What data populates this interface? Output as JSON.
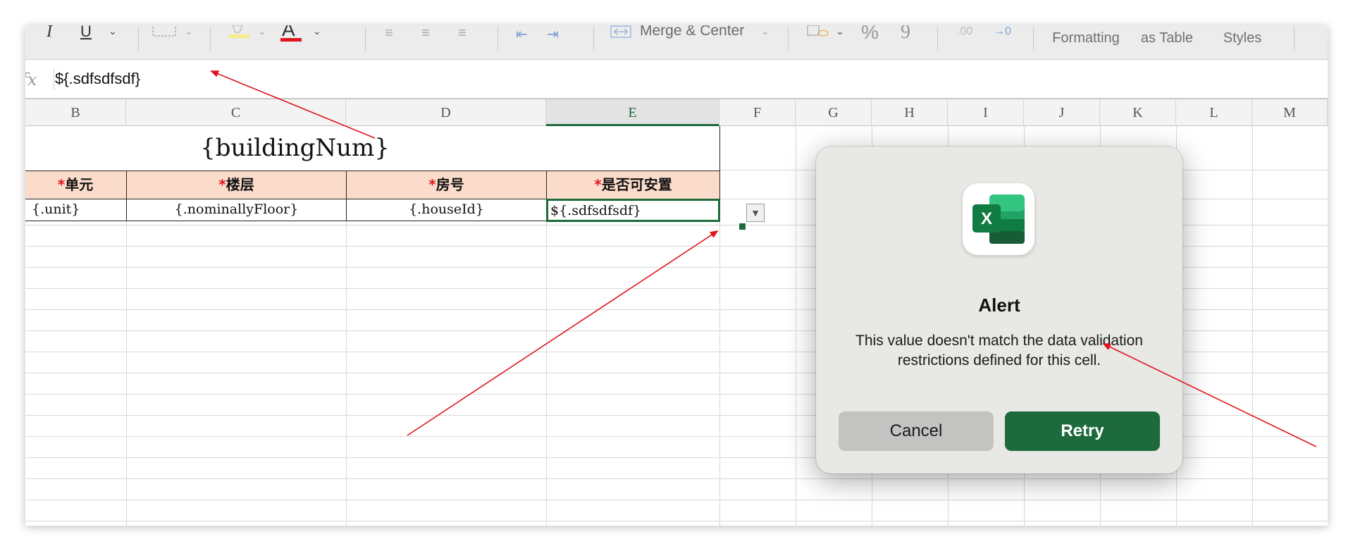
{
  "ribbon": {
    "italic_label": "I",
    "underline_label": "U",
    "font_color_label": "A",
    "merge_label": "Merge & Center",
    "percent_label": "%",
    "comma_label": "9",
    "conditional_formatting": "Conditional Formatting",
    "format_as_table": "Format as Table",
    "cell_styles": "Cell Styles"
  },
  "formula_bar": {
    "fx_label": "fx",
    "value": "${.sdfsdfsdf}"
  },
  "columns": [
    {
      "label": "B"
    },
    {
      "label": "C"
    },
    {
      "label": "D"
    },
    {
      "label": "E"
    },
    {
      "label": "F"
    },
    {
      "label": "G"
    },
    {
      "label": "H"
    },
    {
      "label": "I"
    },
    {
      "label": "J"
    },
    {
      "label": "K"
    },
    {
      "label": "L"
    },
    {
      "label": "M"
    }
  ],
  "sheet": {
    "title": "{buildingNum}",
    "star": "*",
    "headers": [
      "单元",
      "楼层",
      "房号",
      "是否可安置"
    ],
    "row": [
      "{.unit}",
      "{.nominallyFloor}",
      "{.houseId}",
      "${.sdfsdfsdf}"
    ]
  },
  "dialog": {
    "app_icon_letter": "X",
    "title": "Alert",
    "message": "This value doesn't match the data validation restrictions defined for this cell.",
    "cancel_label": "Cancel",
    "retry_label": "Retry",
    "colors": {
      "excel_green": "#1d6b3c",
      "annotation_red": "#e0141e"
    }
  }
}
